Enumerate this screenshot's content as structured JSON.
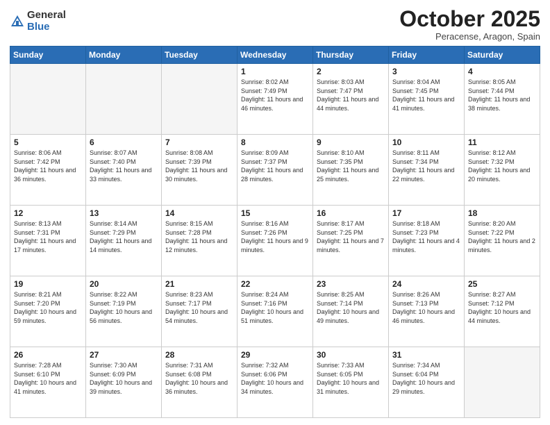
{
  "logo": {
    "general": "General",
    "blue": "Blue"
  },
  "header": {
    "month": "October 2025",
    "location": "Peracense, Aragon, Spain"
  },
  "weekdays": [
    "Sunday",
    "Monday",
    "Tuesday",
    "Wednesday",
    "Thursday",
    "Friday",
    "Saturday"
  ],
  "weeks": [
    [
      {
        "day": "",
        "sunrise": "",
        "sunset": "",
        "daylight": ""
      },
      {
        "day": "",
        "sunrise": "",
        "sunset": "",
        "daylight": ""
      },
      {
        "day": "",
        "sunrise": "",
        "sunset": "",
        "daylight": ""
      },
      {
        "day": "1",
        "sunrise": "Sunrise: 8:02 AM",
        "sunset": "Sunset: 7:49 PM",
        "daylight": "Daylight: 11 hours and 46 minutes."
      },
      {
        "day": "2",
        "sunrise": "Sunrise: 8:03 AM",
        "sunset": "Sunset: 7:47 PM",
        "daylight": "Daylight: 11 hours and 44 minutes."
      },
      {
        "day": "3",
        "sunrise": "Sunrise: 8:04 AM",
        "sunset": "Sunset: 7:45 PM",
        "daylight": "Daylight: 11 hours and 41 minutes."
      },
      {
        "day": "4",
        "sunrise": "Sunrise: 8:05 AM",
        "sunset": "Sunset: 7:44 PM",
        "daylight": "Daylight: 11 hours and 38 minutes."
      }
    ],
    [
      {
        "day": "5",
        "sunrise": "Sunrise: 8:06 AM",
        "sunset": "Sunset: 7:42 PM",
        "daylight": "Daylight: 11 hours and 36 minutes."
      },
      {
        "day": "6",
        "sunrise": "Sunrise: 8:07 AM",
        "sunset": "Sunset: 7:40 PM",
        "daylight": "Daylight: 11 hours and 33 minutes."
      },
      {
        "day": "7",
        "sunrise": "Sunrise: 8:08 AM",
        "sunset": "Sunset: 7:39 PM",
        "daylight": "Daylight: 11 hours and 30 minutes."
      },
      {
        "day": "8",
        "sunrise": "Sunrise: 8:09 AM",
        "sunset": "Sunset: 7:37 PM",
        "daylight": "Daylight: 11 hours and 28 minutes."
      },
      {
        "day": "9",
        "sunrise": "Sunrise: 8:10 AM",
        "sunset": "Sunset: 7:35 PM",
        "daylight": "Daylight: 11 hours and 25 minutes."
      },
      {
        "day": "10",
        "sunrise": "Sunrise: 8:11 AM",
        "sunset": "Sunset: 7:34 PM",
        "daylight": "Daylight: 11 hours and 22 minutes."
      },
      {
        "day": "11",
        "sunrise": "Sunrise: 8:12 AM",
        "sunset": "Sunset: 7:32 PM",
        "daylight": "Daylight: 11 hours and 20 minutes."
      }
    ],
    [
      {
        "day": "12",
        "sunrise": "Sunrise: 8:13 AM",
        "sunset": "Sunset: 7:31 PM",
        "daylight": "Daylight: 11 hours and 17 minutes."
      },
      {
        "day": "13",
        "sunrise": "Sunrise: 8:14 AM",
        "sunset": "Sunset: 7:29 PM",
        "daylight": "Daylight: 11 hours and 14 minutes."
      },
      {
        "day": "14",
        "sunrise": "Sunrise: 8:15 AM",
        "sunset": "Sunset: 7:28 PM",
        "daylight": "Daylight: 11 hours and 12 minutes."
      },
      {
        "day": "15",
        "sunrise": "Sunrise: 8:16 AM",
        "sunset": "Sunset: 7:26 PM",
        "daylight": "Daylight: 11 hours and 9 minutes."
      },
      {
        "day": "16",
        "sunrise": "Sunrise: 8:17 AM",
        "sunset": "Sunset: 7:25 PM",
        "daylight": "Daylight: 11 hours and 7 minutes."
      },
      {
        "day": "17",
        "sunrise": "Sunrise: 8:18 AM",
        "sunset": "Sunset: 7:23 PM",
        "daylight": "Daylight: 11 hours and 4 minutes."
      },
      {
        "day": "18",
        "sunrise": "Sunrise: 8:20 AM",
        "sunset": "Sunset: 7:22 PM",
        "daylight": "Daylight: 11 hours and 2 minutes."
      }
    ],
    [
      {
        "day": "19",
        "sunrise": "Sunrise: 8:21 AM",
        "sunset": "Sunset: 7:20 PM",
        "daylight": "Daylight: 10 hours and 59 minutes."
      },
      {
        "day": "20",
        "sunrise": "Sunrise: 8:22 AM",
        "sunset": "Sunset: 7:19 PM",
        "daylight": "Daylight: 10 hours and 56 minutes."
      },
      {
        "day": "21",
        "sunrise": "Sunrise: 8:23 AM",
        "sunset": "Sunset: 7:17 PM",
        "daylight": "Daylight: 10 hours and 54 minutes."
      },
      {
        "day": "22",
        "sunrise": "Sunrise: 8:24 AM",
        "sunset": "Sunset: 7:16 PM",
        "daylight": "Daylight: 10 hours and 51 minutes."
      },
      {
        "day": "23",
        "sunrise": "Sunrise: 8:25 AM",
        "sunset": "Sunset: 7:14 PM",
        "daylight": "Daylight: 10 hours and 49 minutes."
      },
      {
        "day": "24",
        "sunrise": "Sunrise: 8:26 AM",
        "sunset": "Sunset: 7:13 PM",
        "daylight": "Daylight: 10 hours and 46 minutes."
      },
      {
        "day": "25",
        "sunrise": "Sunrise: 8:27 AM",
        "sunset": "Sunset: 7:12 PM",
        "daylight": "Daylight: 10 hours and 44 minutes."
      }
    ],
    [
      {
        "day": "26",
        "sunrise": "Sunrise: 7:28 AM",
        "sunset": "Sunset: 6:10 PM",
        "daylight": "Daylight: 10 hours and 41 minutes."
      },
      {
        "day": "27",
        "sunrise": "Sunrise: 7:30 AM",
        "sunset": "Sunset: 6:09 PM",
        "daylight": "Daylight: 10 hours and 39 minutes."
      },
      {
        "day": "28",
        "sunrise": "Sunrise: 7:31 AM",
        "sunset": "Sunset: 6:08 PM",
        "daylight": "Daylight: 10 hours and 36 minutes."
      },
      {
        "day": "29",
        "sunrise": "Sunrise: 7:32 AM",
        "sunset": "Sunset: 6:06 PM",
        "daylight": "Daylight: 10 hours and 34 minutes."
      },
      {
        "day": "30",
        "sunrise": "Sunrise: 7:33 AM",
        "sunset": "Sunset: 6:05 PM",
        "daylight": "Daylight: 10 hours and 31 minutes."
      },
      {
        "day": "31",
        "sunrise": "Sunrise: 7:34 AM",
        "sunset": "Sunset: 6:04 PM",
        "daylight": "Daylight: 10 hours and 29 minutes."
      },
      {
        "day": "",
        "sunrise": "",
        "sunset": "",
        "daylight": ""
      }
    ]
  ]
}
